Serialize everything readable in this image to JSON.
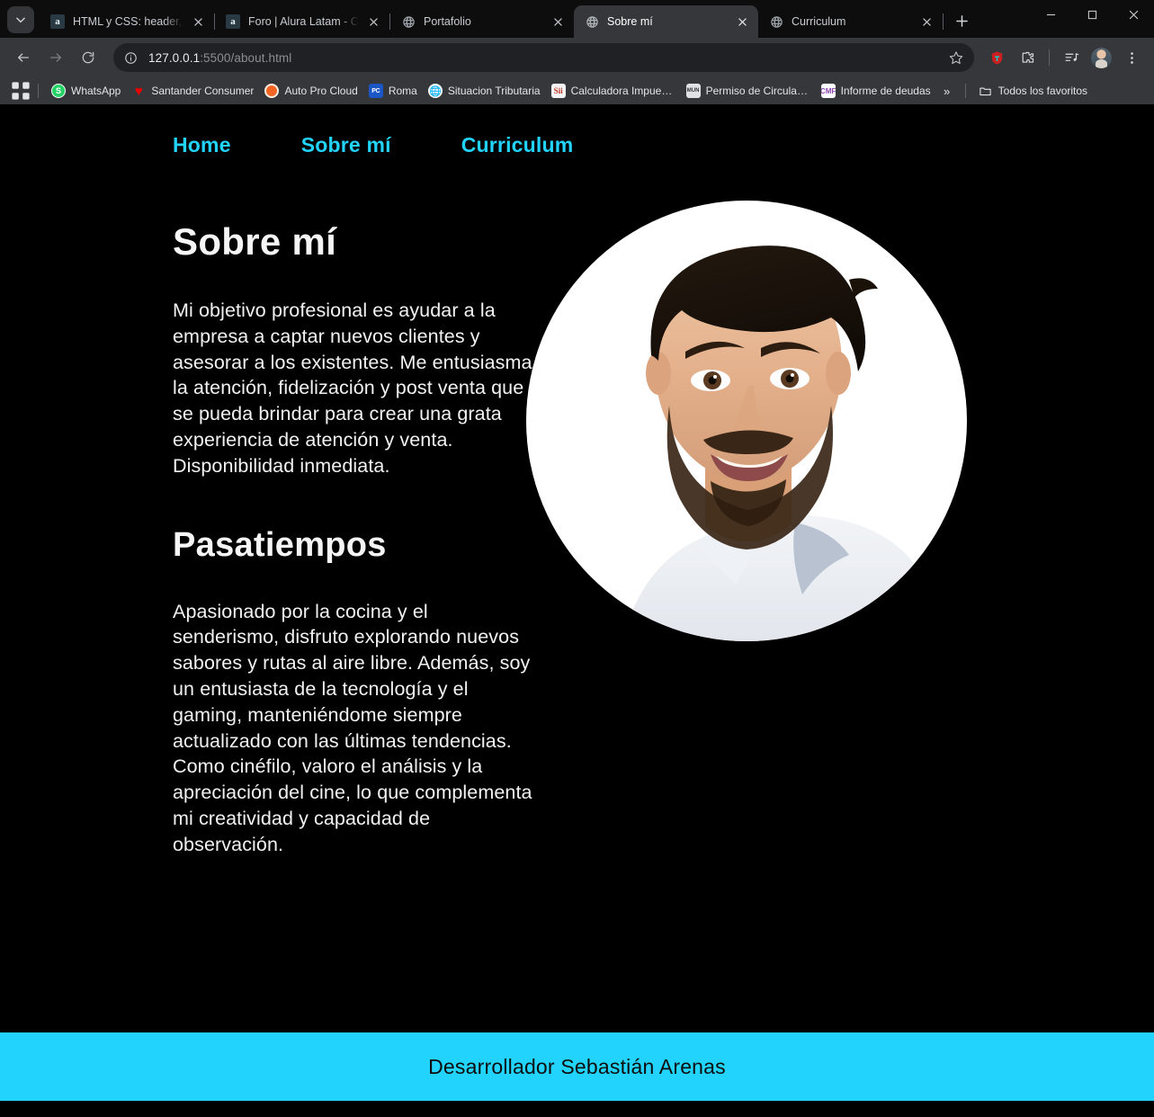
{
  "browser": {
    "tabs": [
      {
        "title": "HTML y CSS: header, foot",
        "favicon": "alura-icon",
        "active": false
      },
      {
        "title": "Foro | Alura Latam - Curs",
        "favicon": "alura-icon",
        "active": false
      },
      {
        "title": "Portafolio",
        "favicon": "globe-icon",
        "active": false
      },
      {
        "title": "Sobre mí",
        "favicon": "globe-icon",
        "active": true
      },
      {
        "title": "Curriculum",
        "favicon": "globe-icon",
        "active": false
      }
    ],
    "tab_list_button": "tab-search-icon",
    "new_tab_label": "+",
    "window_controls": [
      "minimize",
      "maximize",
      "close"
    ],
    "toolbar": {
      "back": "back-arrow-icon",
      "forward": "forward-arrow-icon",
      "reload": "reload-icon",
      "site_info": "info-circle-icon",
      "url_host": "127.0.0.1",
      "url_rest": ":5500/about.html",
      "bookmark_star": "star-icon",
      "icons": [
        "extension-red-icon",
        "extensions-puzzle-icon",
        "media-list-icon"
      ],
      "profile": "profile-avatar",
      "menu": "three-dot-menu-icon"
    },
    "bookmarks": {
      "apps_icon": "apps-grid-icon",
      "items": [
        {
          "label": "WhatsApp",
          "icon": "whatsapp-icon"
        },
        {
          "label": "Santander Consumer",
          "icon": "santander-icon"
        },
        {
          "label": "Auto Pro Cloud",
          "icon": "autoprocloud-icon"
        },
        {
          "label": "Roma",
          "icon": "roma-icon"
        },
        {
          "label": "Situacion Tributaria",
          "icon": "sii-icon"
        },
        {
          "label": "Calculadora Impues...",
          "icon": "calculadora-icon"
        },
        {
          "label": "Permiso de Circulaci...",
          "icon": "permiso-icon"
        },
        {
          "label": "Informe de deudas",
          "icon": "informe-icon"
        }
      ],
      "overflow": "»",
      "all_bookmarks": "Todos los favoritos"
    }
  },
  "page": {
    "nav": [
      {
        "label": "Home"
      },
      {
        "label": "Sobre mí"
      },
      {
        "label": "Curriculum"
      }
    ],
    "title": "Sobre mí",
    "paragraph1": "Mi objetivo profesional es ayudar a la empresa a captar nuevos clientes y asesorar a los existentes. Me entusiasma la atención, fidelización y post venta que se pueda brindar para crear una grata experiencia de atención y venta. Disponibilidad inmediata.",
    "subtitle": "Pasatiempos",
    "paragraph2": "Apasionado por la cocina y el senderismo, disfruto explorando nuevos sabores y rutas al aire libre. Además, soy un entusiasta de la tecnología y el gaming, manteniéndome siempre actualizado con las últimas tendencias. Como cinéfilo, valoro el análisis y la apreciación del cine, lo que complementa mi creatividad y capacidad de observación.",
    "photo_alt": "Foto de perfil circular",
    "footer_text": "Desarrollador Sebastián Arenas"
  },
  "colors": {
    "accent": "#22d4fd",
    "page_bg": "#000000",
    "text": "#f2f2f2",
    "footer_text": "#0d0d0d"
  }
}
